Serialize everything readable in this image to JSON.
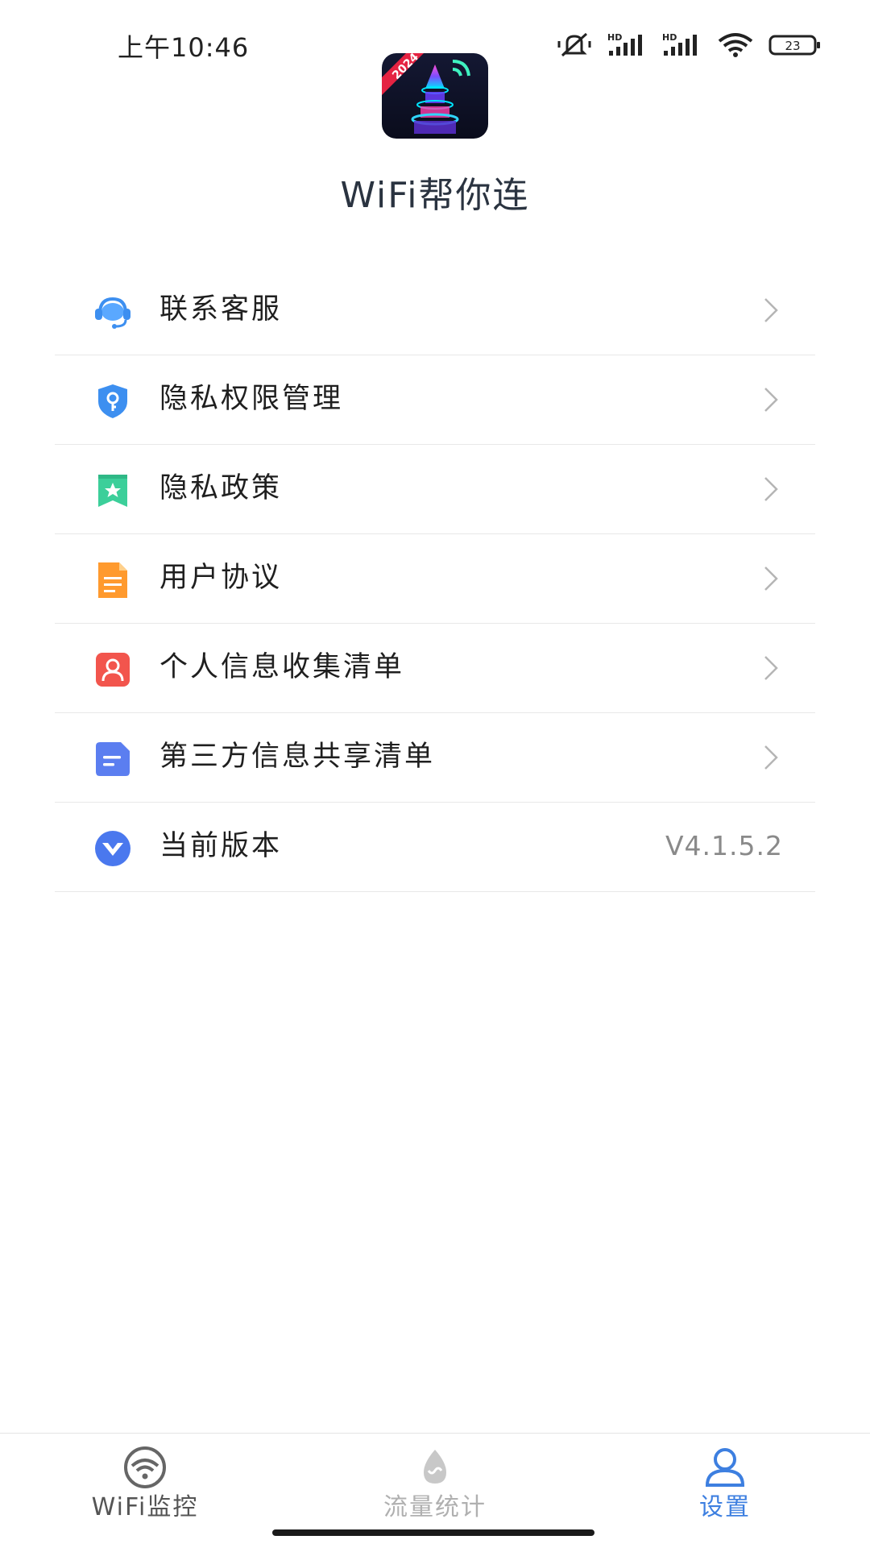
{
  "status_bar": {
    "time": "上午10:46",
    "battery": "23",
    "icons": [
      "mute-icon",
      "hd-signal-icon",
      "hd-signal-icon",
      "wifi-icon",
      "battery-icon"
    ]
  },
  "header": {
    "logo_badge": "2024",
    "app_name": "WiFi帮你连"
  },
  "menu": {
    "items": [
      {
        "label": "联系客服",
        "icon": "headset-icon"
      },
      {
        "label": "隐私权限管理",
        "icon": "shield-key-icon"
      },
      {
        "label": "隐私政策",
        "icon": "bookmark-star-icon"
      },
      {
        "label": "用户协议",
        "icon": "document-icon"
      },
      {
        "label": "个人信息收集清单",
        "icon": "person-card-icon"
      },
      {
        "label": "第三方信息共享清单",
        "icon": "note-icon"
      },
      {
        "label": "当前版本",
        "icon": "version-v-icon",
        "value": "V4.1.5.2"
      }
    ]
  },
  "bottom_nav": {
    "items": [
      {
        "label": "WiFi监控",
        "icon": "wifi-monitor-icon"
      },
      {
        "label": "流量统计",
        "icon": "traffic-drop-icon"
      },
      {
        "label": "设置",
        "icon": "user-settings-icon",
        "active": true
      }
    ]
  },
  "colors": {
    "accent": "#3d7fe0",
    "nav_inactive": "#555555",
    "nav_disabled": "#b0b0b0",
    "divider": "#e8e8e8"
  }
}
